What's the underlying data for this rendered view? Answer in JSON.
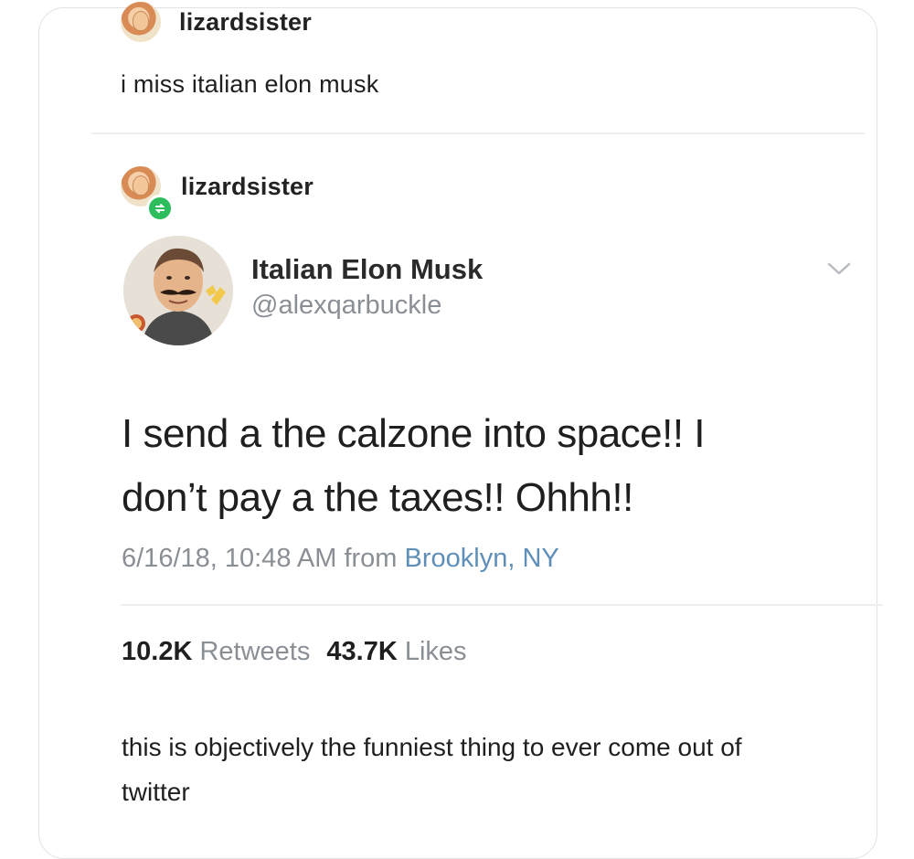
{
  "post": {
    "username": "lizardsister",
    "text": "i miss italian elon musk"
  },
  "reblog": {
    "username": "lizardsister",
    "badge_icon": "reblog-icon",
    "badge_color": "#2dbd5c"
  },
  "tweet": {
    "display_name": "Italian Elon Musk",
    "handle": "@alexqarbuckle",
    "body": "I send a the calzone into space!! I don’t pay a the taxes!! Ohhh!!",
    "date": "6/16/18, 10:48 AM from ",
    "location": "Brooklyn, NY",
    "retweets_count": "10.2K",
    "retweets_label": "Retweets",
    "likes_count": "43.7K",
    "likes_label": "Likes",
    "link_color": "#5f8fb8"
  },
  "comment": {
    "text": "this is objectively the funniest thing to ever come out of twitter"
  }
}
